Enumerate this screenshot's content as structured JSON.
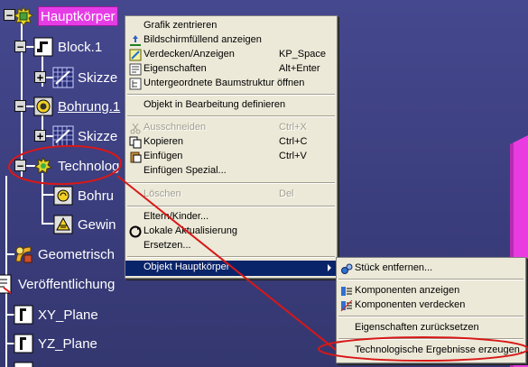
{
  "tree": {
    "root_label": "Hauptkörper",
    "block_label": "Block.1",
    "skizze1_label": "Skizze",
    "bohrung_label": "Bohrung.1",
    "skizze2_label": "Skizze",
    "techno_label": "Technolog",
    "bohrung_child_label": "Bohru",
    "gewinde_child_label": "Gewin",
    "geometrisch_label": "Geometrisch",
    "veroeff_label": "Veröffentlichung",
    "xy_label": "XY_Plane",
    "yz_label": "YZ_Plane"
  },
  "context_menu": {
    "items": [
      {
        "label": "Grafik zentrieren",
        "shortcut": ""
      },
      {
        "label": "Bildschirmfüllend anzeigen",
        "shortcut": ""
      },
      {
        "label": "Verdecken/Anzeigen",
        "shortcut": "KP_Space"
      },
      {
        "label": "Eigenschaften",
        "shortcut": "Alt+Enter"
      },
      {
        "label": "Untergeordnete Baumstruktur öffnen",
        "shortcut": ""
      },
      {
        "label": "Objekt in Bearbeitung definieren",
        "shortcut": ""
      },
      {
        "label": "Ausschneiden",
        "shortcut": "Ctrl+X"
      },
      {
        "label": "Kopieren",
        "shortcut": "Ctrl+C"
      },
      {
        "label": "Einfügen",
        "shortcut": "Ctrl+V"
      },
      {
        "label": "Einfügen Spezial...",
        "shortcut": ""
      },
      {
        "label": "Löschen",
        "shortcut": "Del"
      },
      {
        "label": "Eltern/Kinder...",
        "shortcut": ""
      },
      {
        "label": "Lokale Aktualisierung",
        "shortcut": ""
      },
      {
        "label": "Ersetzen...",
        "shortcut": ""
      },
      {
        "label": "Objekt Hauptkörper",
        "shortcut": ""
      }
    ]
  },
  "submenu": {
    "items": [
      {
        "label": "Stück entfernen..."
      },
      {
        "label": "Komponenten anzeigen"
      },
      {
        "label": "Komponenten verdecken"
      },
      {
        "label": "Eigenschaften zurücksetzen"
      },
      {
        "label": "Technologische Ergebnisse erzeugen..."
      }
    ]
  },
  "colors": {
    "background": "#3c3f80",
    "selection_magenta": "#e63ce6",
    "menu_bg": "#ece9d8",
    "menu_highlight": "#0a246a",
    "annotation_red": "#d81818"
  },
  "icons": {
    "root": "part-body-icon",
    "block": "pad-icon",
    "sketch": "sketch-icon",
    "hole": "hole-icon",
    "techno": "technological-result-icon",
    "geometric": "geometric-set-icon",
    "publication": "publication-icon",
    "plane": "plane-icon"
  }
}
